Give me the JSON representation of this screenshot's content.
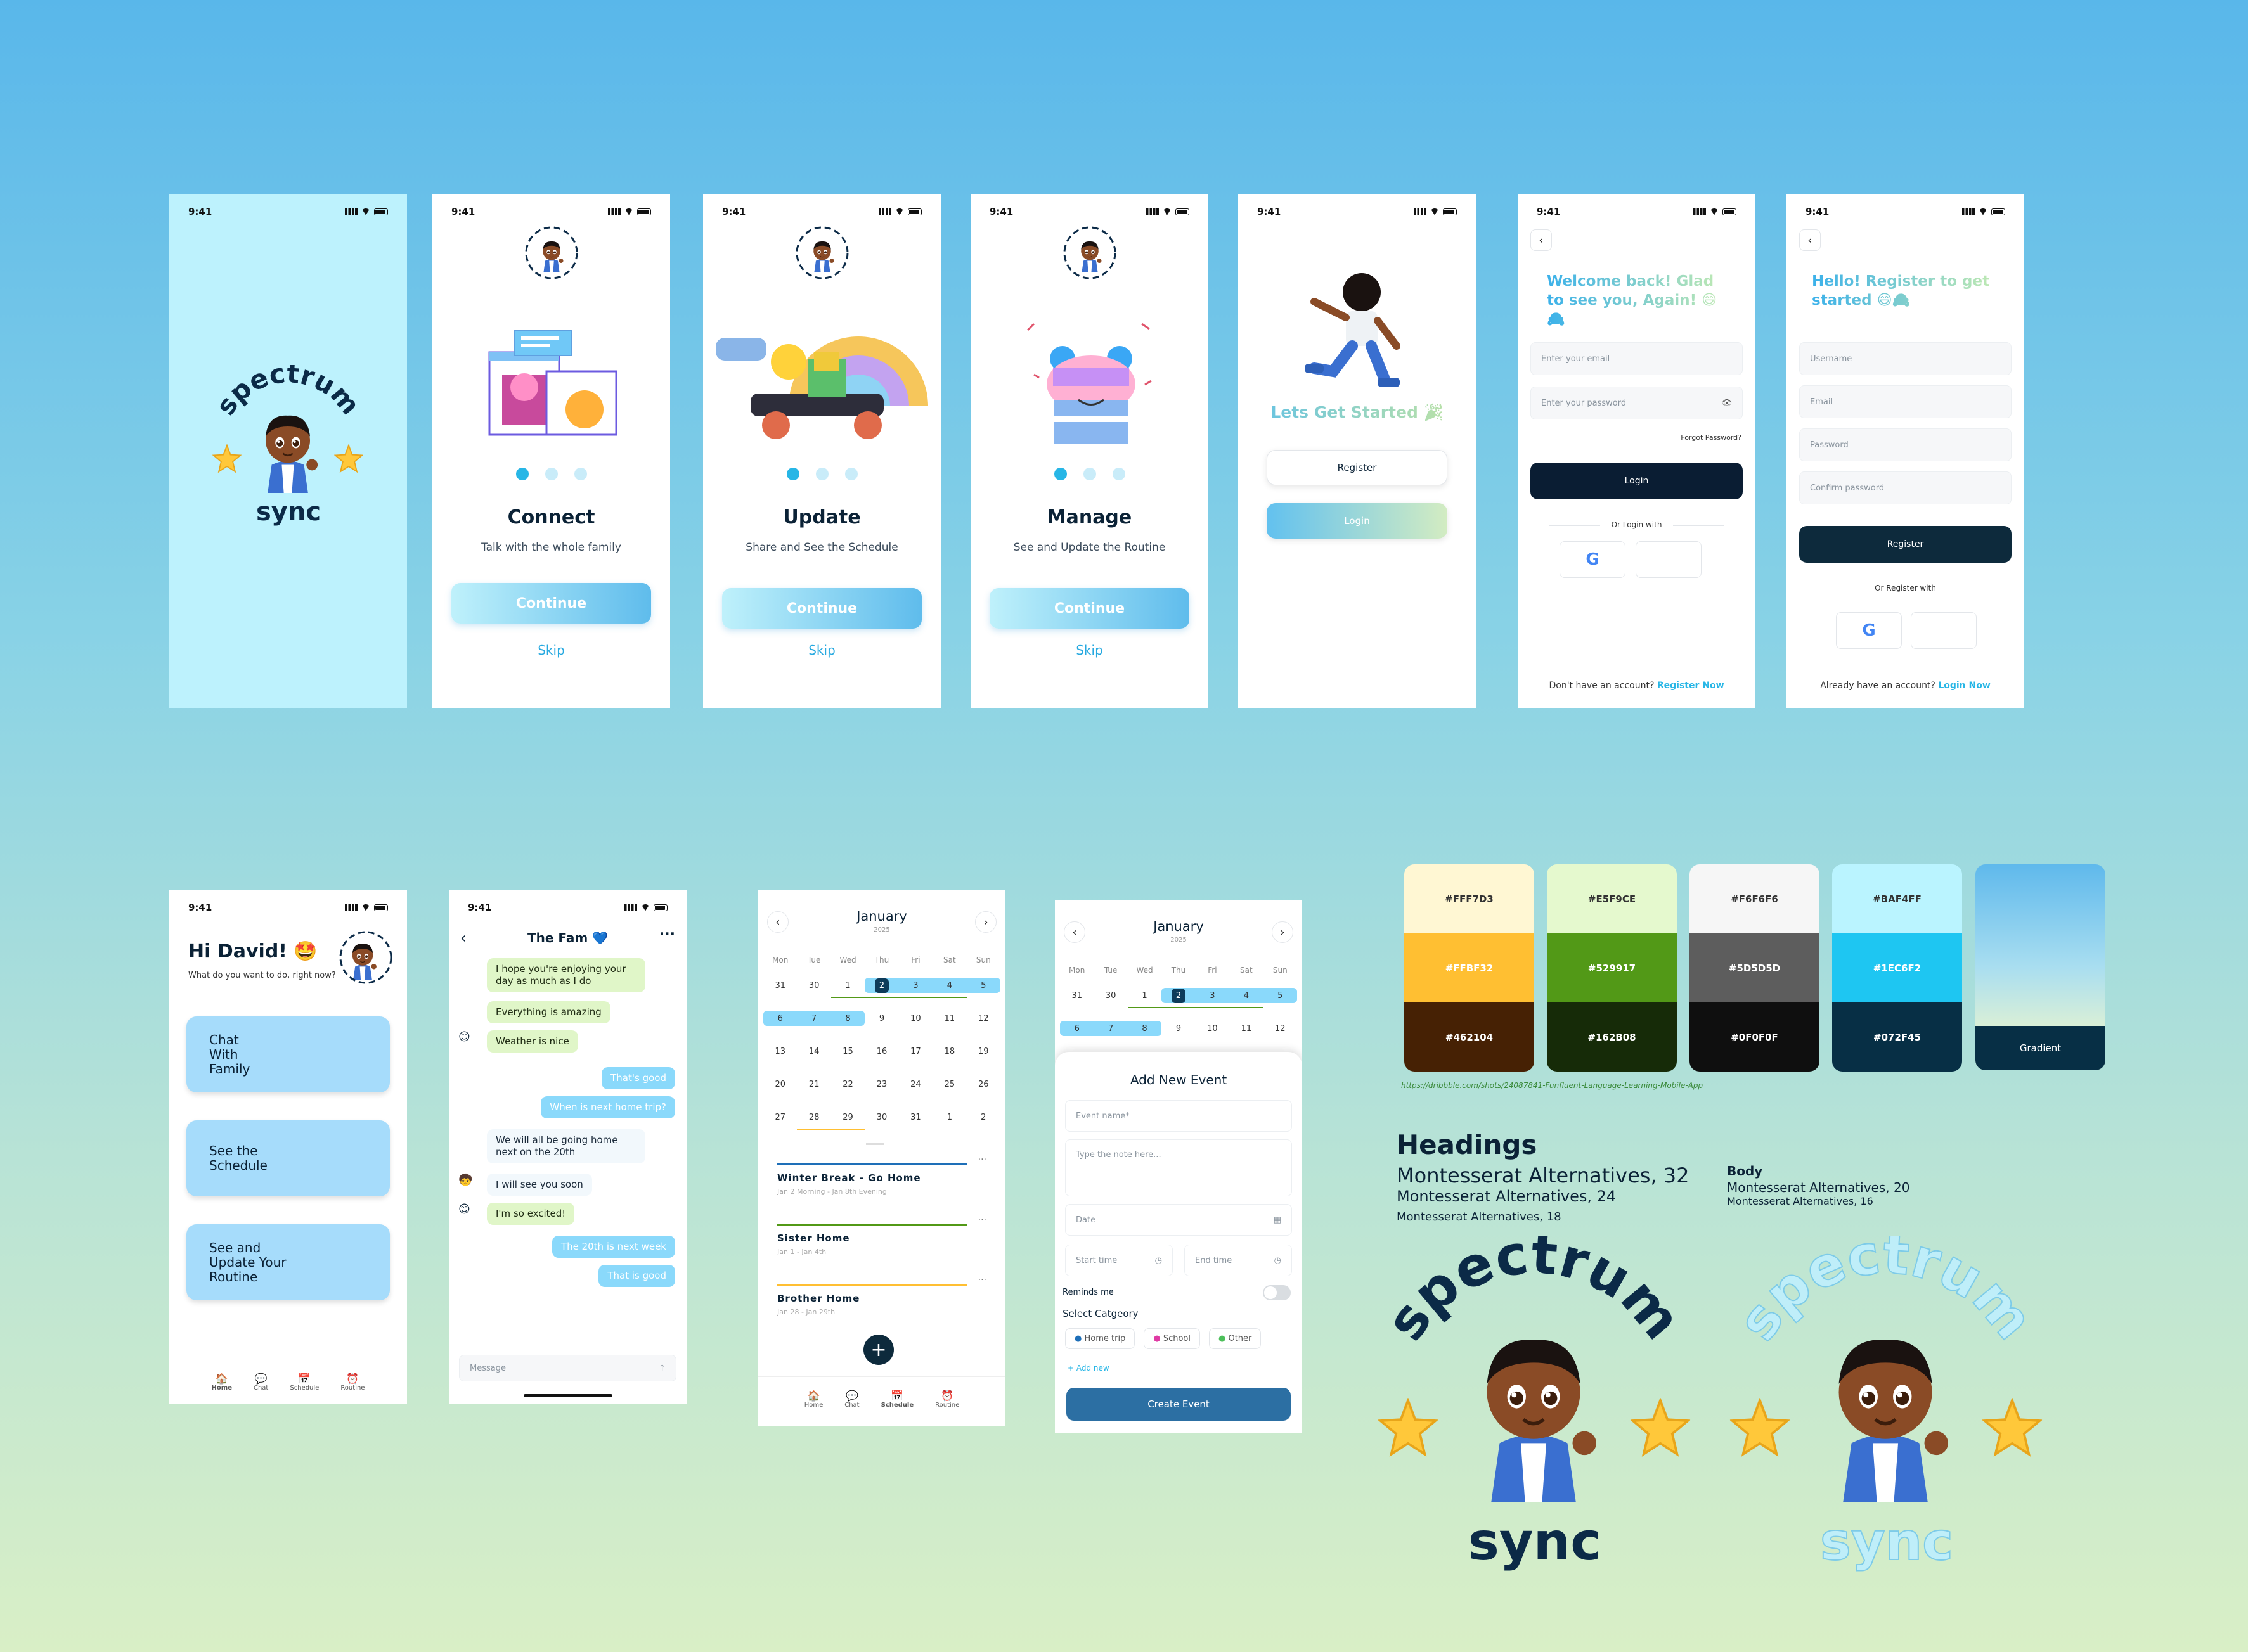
{
  "status": {
    "time": "9:41"
  },
  "splash": {
    "brand_top": "spectrum",
    "brand_bottom": "sync"
  },
  "onb": [
    {
      "title": "Connect",
      "desc": "Talk with the whole family",
      "btn": "Continue",
      "skip": "Skip"
    },
    {
      "title": "Update",
      "desc": "Share and See the Schedule",
      "btn": "Continue",
      "skip": "Skip"
    },
    {
      "title": "Manage",
      "desc": "See and Update the Routine",
      "btn": "Continue",
      "skip": "Skip"
    }
  ],
  "start": {
    "title": "Lets Get Started 🎉",
    "register": "Register",
    "login": "Login"
  },
  "login": {
    "title": "Welcome back! Glad to see you, Again! 😄🙈",
    "email_ph": "Enter your email",
    "pass_ph": "Enter your password",
    "forgot": "Forgot Password?",
    "btn": "Login",
    "or": "Or Login with",
    "no_acc": "Don't have an account?",
    "register_now": "Register Now"
  },
  "reg": {
    "title": "Hello! Register to get started 😄🙈",
    "user_ph": "Username",
    "email_ph": "Email",
    "pass_ph": "Password",
    "confirm_ph": "Confirm password",
    "btn": "Register",
    "or": "Or Register with",
    "have_acc": "Already have an account?",
    "login_now": "Login Now"
  },
  "home": {
    "greet": "Hi David! 🤩",
    "q": "What do you want to do, right now?",
    "cards": [
      "Chat\nWith\nFamily",
      "See the\nSchedule",
      "See and\nUpdate Your\nRoutine"
    ],
    "nav": [
      "Home",
      "Chat",
      "Schedule",
      "Routine"
    ]
  },
  "chat": {
    "title": "The Fam 💙",
    "msgs": [
      {
        "t": "I hope you're enjoying your day as much as I do",
        "s": "g"
      },
      {
        "t": "Everything is amazing",
        "s": "g"
      },
      {
        "t": "Weather is nice",
        "s": "g"
      },
      {
        "t": "That's good",
        "s": "b"
      },
      {
        "t": "When is next home trip?",
        "s": "b"
      },
      {
        "t": "We will all be going home next on the 20th",
        "s": "w"
      },
      {
        "t": "I will see you soon",
        "s": "w"
      },
      {
        "t": "I'm so excited!",
        "s": "g"
      },
      {
        "t": "The 20th is next week",
        "s": "b"
      },
      {
        "t": "That is good",
        "s": "b"
      }
    ],
    "placeholder": "Message"
  },
  "sched": {
    "month": "January",
    "year": "2025",
    "days": [
      "Mon",
      "Tue",
      "Wed",
      "Thu",
      "Fri",
      "Sat",
      "Sun"
    ],
    "dates": [
      "31",
      "30",
      "1",
      "2",
      "3",
      "4",
      "5",
      "6",
      "7",
      "8",
      "9",
      "10",
      "11",
      "12",
      "13",
      "14",
      "15",
      "16",
      "17",
      "18",
      "19",
      "20",
      "21",
      "22",
      "23",
      "24",
      "25",
      "26",
      "27",
      "28",
      "29",
      "30",
      "31",
      "1",
      "2"
    ],
    "events": [
      {
        "name": "Winter Break -  Go Home",
        "date": "Jan 2 Morning - Jan 8th Evening"
      },
      {
        "name": "Sister Home",
        "date": "Jan 1 - Jan 4th"
      },
      {
        "name": "Brother Home",
        "date": "Jan 28 - Jan 29th"
      }
    ]
  },
  "addev": {
    "title": "Add New Event",
    "name_ph": "Event name*",
    "note_ph": "Type the note here...",
    "date_ph": "Date",
    "start_ph": "Start time",
    "end_ph": "End time",
    "remind": "Reminds me",
    "cat": "Select Catgeory",
    "cats": [
      "Home trip",
      "School",
      "Other"
    ],
    "add_new": "+ Add new",
    "btn": "Create Event"
  },
  "palette": [
    {
      "c": [
        "#FFF7D3",
        "#FFBF32",
        "#462104"
      ]
    },
    {
      "c": [
        "#E5F9CE",
        "#529917",
        "#162B08"
      ]
    },
    {
      "c": [
        "#F6F6F6",
        "#5D5D5D",
        "#0F0F0F"
      ]
    },
    {
      "c": [
        "#BAF4FF",
        "#1EC6F2",
        "#072F45"
      ]
    }
  ],
  "gradient_label": "Gradient",
  "link": "https://dribbble.com/shots/24087841-Funfluent-Language-Learning-Mobile-App",
  "typo": {
    "h": "Headings",
    "h1": "Montesserat Alternatives, 32",
    "h2": "Montesserat Alternatives, 24",
    "h3": "Montesserat Alternatives, 18",
    "b": "Body",
    "b1": "Montesserat Alternatives, 20",
    "b2": "Montesserat Alternatives, 16"
  },
  "colors": {
    "accent": "#27b6e6",
    "dark": "#0a1d33",
    "chat_green": "#e0f6c8",
    "chat_blue": "#8ad9fb"
  }
}
